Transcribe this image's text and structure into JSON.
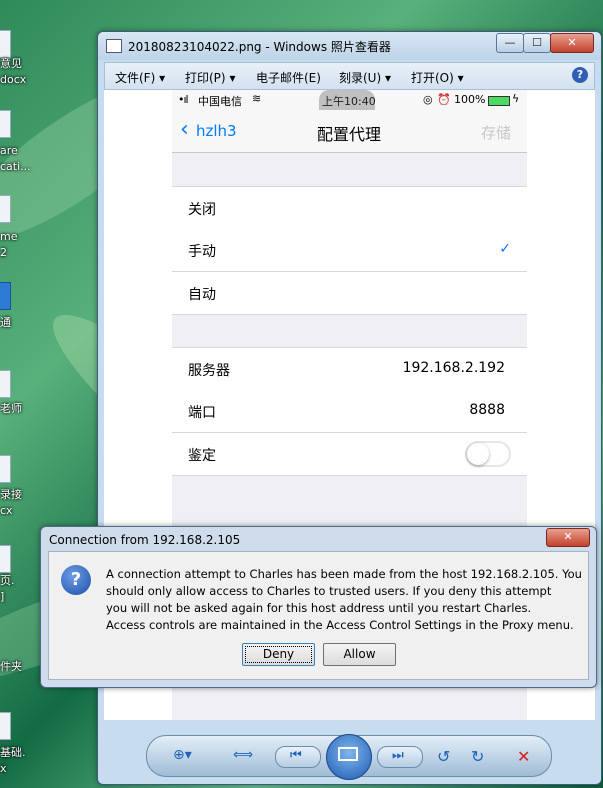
{
  "desktop": {
    "labels": [
      "意见",
      "docx",
      "are",
      "cati...",
      "me",
      "2",
      "通",
      "老师",
      "录接",
      "cx",
      "页.",
      "]",
      "件夹",
      "基础.",
      "x"
    ]
  },
  "viewer": {
    "title": "20180823104022.png - Windows 照片查看器",
    "controls": {
      "minimize": "—",
      "maximize": "☐",
      "close": "✕"
    },
    "menu": [
      {
        "label": "文件(F)",
        "arrow": "▾"
      },
      {
        "label": "打印(P)",
        "arrow": "▾"
      },
      {
        "label": "电子邮件(E)",
        "arrow": ""
      },
      {
        "label": "刻录(U)",
        "arrow": "▾"
      },
      {
        "label": "打开(O)",
        "arrow": "▾"
      }
    ],
    "help": "?"
  },
  "phone": {
    "status": {
      "carrier": "中国电信",
      "time": "上午10:40",
      "battery": "100%"
    },
    "nav": {
      "back": "hzlh3",
      "title": "配置代理",
      "save": "存储"
    },
    "modes": [
      {
        "label": "关闭",
        "checked": false
      },
      {
        "label": "手动",
        "checked": true
      },
      {
        "label": "自动",
        "checked": false
      }
    ],
    "check_mark": "✓",
    "server": {
      "label": "服务器",
      "value": "192.168.2.192"
    },
    "port": {
      "label": "端口",
      "value": "8888"
    },
    "auth": {
      "label": "鉴定",
      "enabled": false
    }
  },
  "dialog": {
    "title": "Connection from 192.168.2.105",
    "close": "✕",
    "lines": [
      "A connection attempt to Charles has been made from the host 192.168.2.105. You",
      "should only allow access to Charles to trusted users. If you deny this attempt",
      "you will not be asked again for this host address until you restart Charles.",
      "Access controls are maintained in the Access Control Settings in the Proxy menu."
    ],
    "deny": "Deny",
    "allow": "Allow"
  },
  "toolbar_icons": [
    "zoom-icon",
    "actual-size-icon",
    "previous-icon",
    "slideshow-icon",
    "next-icon",
    "rotate-left-icon",
    "rotate-right-icon",
    "delete-icon"
  ],
  "colors": {
    "ios_blue": "#007aff",
    "accent_blue": "#1e63b8"
  }
}
